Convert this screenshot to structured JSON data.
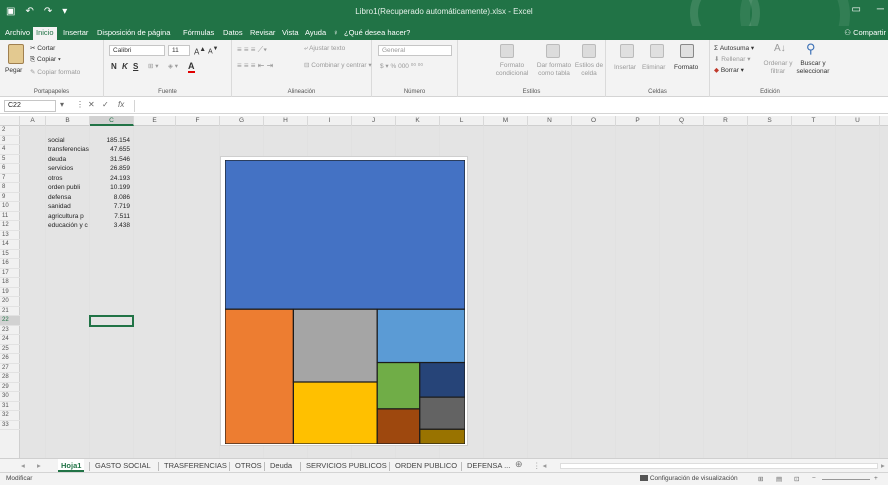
{
  "window": {
    "title": "Libro1(Recuperado automáticamente).xlsx  -  Excel",
    "share": "Compartir"
  },
  "menu": {
    "tabs": [
      "Archivo",
      "Inicio",
      "Insertar",
      "Disposición de página",
      "Fórmulas",
      "Datos",
      "Revisar",
      "Vista",
      "Ayuda"
    ],
    "active": "Inicio",
    "tell_me": "¿Qué desea hacer?"
  },
  "ribbon": {
    "clipboard": {
      "paste": "Pegar",
      "cut": "Cortar",
      "copy": "Copiar",
      "format_painter": "Copiar formato",
      "label": "Portapapeles"
    },
    "font": {
      "name": "Calibri",
      "size": "11",
      "bold": "N",
      "italic": "K",
      "underline": "S",
      "label": "Fuente"
    },
    "alignment": {
      "wrap": "Ajustar texto",
      "merge": "Combinar y centrar",
      "label": "Alineación"
    },
    "number": {
      "format": "General",
      "label": "Número"
    },
    "styles": {
      "conditional": "Formato condicional",
      "table": "Dar formato como tabla",
      "cell_styles": "Estilos de celda",
      "label": "Estilos"
    },
    "cells": {
      "insert": "Insertar",
      "delete": "Eliminar",
      "format": "Formato",
      "label": "Celdas"
    },
    "editing": {
      "autosum": "Autosuma",
      "fill": "Rellenar",
      "clear": "Borrar",
      "sort": "Ordenar y filtrar",
      "find": "Buscar y seleccionar",
      "label": "Edición"
    }
  },
  "formula_bar": {
    "name_box": "C22",
    "cancel": "✕",
    "enter": "✓",
    "fx": "fx",
    "content": ""
  },
  "columns": [
    "A",
    "B",
    "C",
    "E",
    "F",
    "G",
    "H",
    "I",
    "J",
    "K",
    "L",
    "M",
    "N",
    "O",
    "P",
    "Q",
    "R",
    "S",
    "T",
    "U"
  ],
  "rows": [
    "2",
    "3",
    "4",
    "5",
    "6",
    "7",
    "8",
    "9",
    "10",
    "11",
    "12",
    "13",
    "14",
    "15",
    "16",
    "17",
    "18",
    "19",
    "20",
    "21",
    "22",
    "23",
    "24",
    "25",
    "26",
    "27",
    "28",
    "29",
    "30",
    "31",
    "32",
    "33"
  ],
  "selected_cell": {
    "column": "C",
    "row": "22"
  },
  "table": [
    {
      "label": "social",
      "value": "185.154"
    },
    {
      "label": "transferencias",
      "value": "47.655"
    },
    {
      "label": "deuda",
      "value": "31.546"
    },
    {
      "label": "servicios",
      "value": "26.859"
    },
    {
      "label": "otros",
      "value": "24.193"
    },
    {
      "label": "orden publi",
      "value": "10.199"
    },
    {
      "label": "defensa",
      "value": "8.086"
    },
    {
      "label": "sanidad",
      "value": "7.719"
    },
    {
      "label": "agricultura p",
      "value": "7.511"
    },
    {
      "label": "educación y c",
      "value": "3.438"
    }
  ],
  "chart_data": {
    "type": "treemap",
    "categories": [
      "social",
      "transferencias",
      "deuda",
      "servicios",
      "otros",
      "orden publi",
      "defensa",
      "sanidad",
      "agricultura p",
      "educación y c"
    ],
    "values": [
      185.154,
      47.655,
      31.546,
      26.859,
      24.193,
      10.199,
      8.086,
      7.719,
      7.511,
      3.438
    ],
    "colors": [
      "#4472C4",
      "#ED7D31",
      "#A5A5A5",
      "#FFC000",
      "#5B9BD5",
      "#70AD47",
      "#264478",
      "#9E480E",
      "#636363",
      "#997300"
    ],
    "title": ""
  },
  "sheets": {
    "tabs": [
      "Hoja1",
      "GASTO SOCIAL",
      "TRASFERENCIAS",
      "OTROS",
      "Deuda",
      "SERVICIOS PUBLICOS",
      "ORDEN PUBLICO",
      "DEFENSA ..."
    ],
    "active": "Hoja1",
    "add": "⊕"
  },
  "status": {
    "mode": "Modificar",
    "display_settings": "Configuración de visualización",
    "zoom_minus": "−",
    "zoom_plus": "+"
  }
}
